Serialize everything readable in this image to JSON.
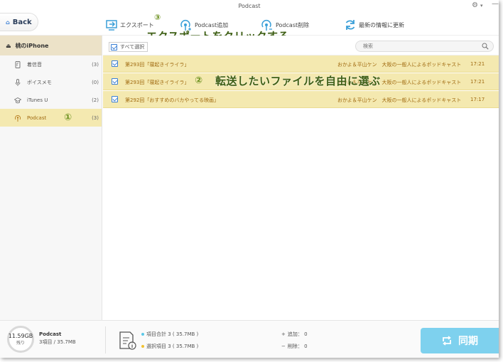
{
  "window": {
    "title": "Podcast"
  },
  "header": {
    "back_label": "Back",
    "toolbar": [
      {
        "label": "エクスポート",
        "icon": "export-icon"
      },
      {
        "label": "Podcast追加",
        "icon": "podcast-add-icon"
      },
      {
        "label": "Podcast削除",
        "icon": "podcast-delete-icon"
      },
      {
        "label": "最新の情報に更新",
        "icon": "refresh-icon"
      }
    ]
  },
  "annotations": {
    "step1_num": "①",
    "step2_num": "②",
    "step2_text": "転送したいファイルを自由に選ぶ",
    "step3_num": "③",
    "step3_text": "エクスポートをクリックする"
  },
  "sidebar": {
    "device_name": "桃のiPhone",
    "items": [
      {
        "label": "着信音",
        "count": "(3)",
        "icon": "ringtone-icon"
      },
      {
        "label": "ボイスメモ",
        "count": "(0)",
        "icon": "voice-memo-icon"
      },
      {
        "label": "iTunes U",
        "count": "(2)",
        "icon": "itunes-u-icon"
      },
      {
        "label": "Podcast",
        "count": "(3)",
        "icon": "podcast-icon"
      }
    ]
  },
  "list": {
    "select_all_label": "すべて選択",
    "search_placeholder": "検索",
    "rows": [
      {
        "title": "第293回「寝起きイライラ」",
        "artist": "おかよ＆平山ケン　大阪の一般人によるポッドキャスト",
        "time": "17:21"
      },
      {
        "title": "第293回「寝起きイライラ」",
        "artist": "おかよ＆平山ケン　大阪の一般人によるポッドキャスト",
        "time": "17:21"
      },
      {
        "title": "第292回「おすすめのバカやってる映画」",
        "artist": "おかよ＆平山ケン　大阪の一般人によるポッドキャスト",
        "time": "17:17"
      }
    ]
  },
  "footer": {
    "storage_free": "11.59GB",
    "storage_label": "残り",
    "category": "Podcast",
    "category_summary": "3項目 / 35.7MB",
    "total_label": "項目合計 3 ( 35.7MB )",
    "selected_label": "選択項目 3 ( 35.7MB )",
    "add_label": "追加： 0",
    "delete_label": "削除： 0",
    "sync_label": "同期"
  },
  "colors": {
    "accent": "#3a7fd5",
    "row_selected": "#f4e9b0",
    "annotation": "#3d5e14",
    "sync": "#7ed1ee"
  }
}
